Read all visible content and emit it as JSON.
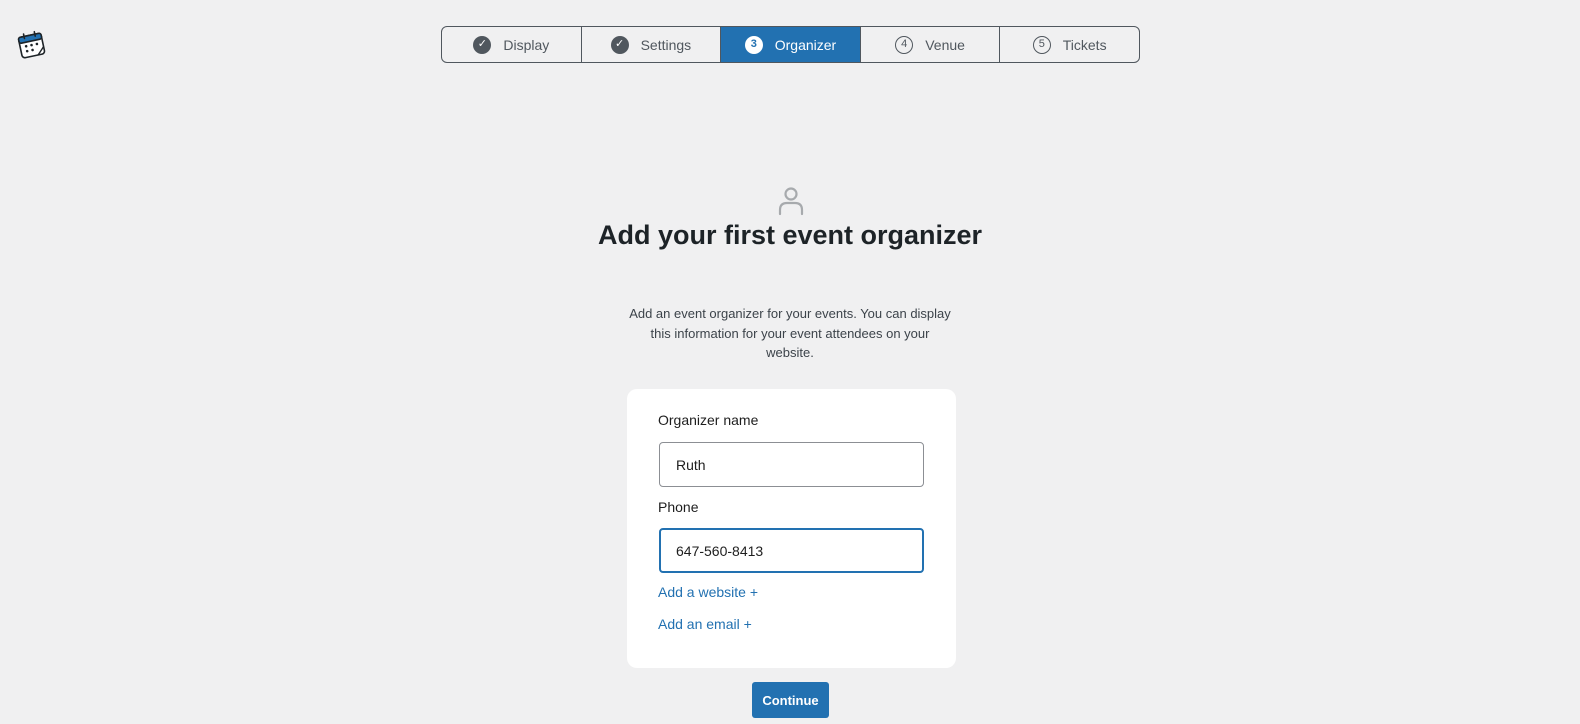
{
  "logo": {
    "icon": "calendar-logo-icon"
  },
  "steps": [
    {
      "label": "Display",
      "badge": "✓",
      "state": "done"
    },
    {
      "label": "Settings",
      "badge": "✓",
      "state": "done"
    },
    {
      "label": "Organizer",
      "badge": "3",
      "state": "active"
    },
    {
      "label": "Venue",
      "badge": "4",
      "state": "todo"
    },
    {
      "label": "Tickets",
      "badge": "5",
      "state": "todo"
    }
  ],
  "header": {
    "icon": "person-icon",
    "title": "Add your first event organizer",
    "description": "Add an event organizer for your events. You can display this information for your event attendees on your website."
  },
  "form": {
    "organizer_label": "Organizer name",
    "organizer_value": "Ruth",
    "phone_label": "Phone",
    "phone_value": "647-560-8413",
    "add_website": "Add a website +",
    "add_email": "Add an email +"
  },
  "continue_label": "Continue",
  "colors": {
    "accent": "#2271b1",
    "background": "#f0f0f1",
    "card": "#ffffff",
    "muted": "#50575e"
  }
}
